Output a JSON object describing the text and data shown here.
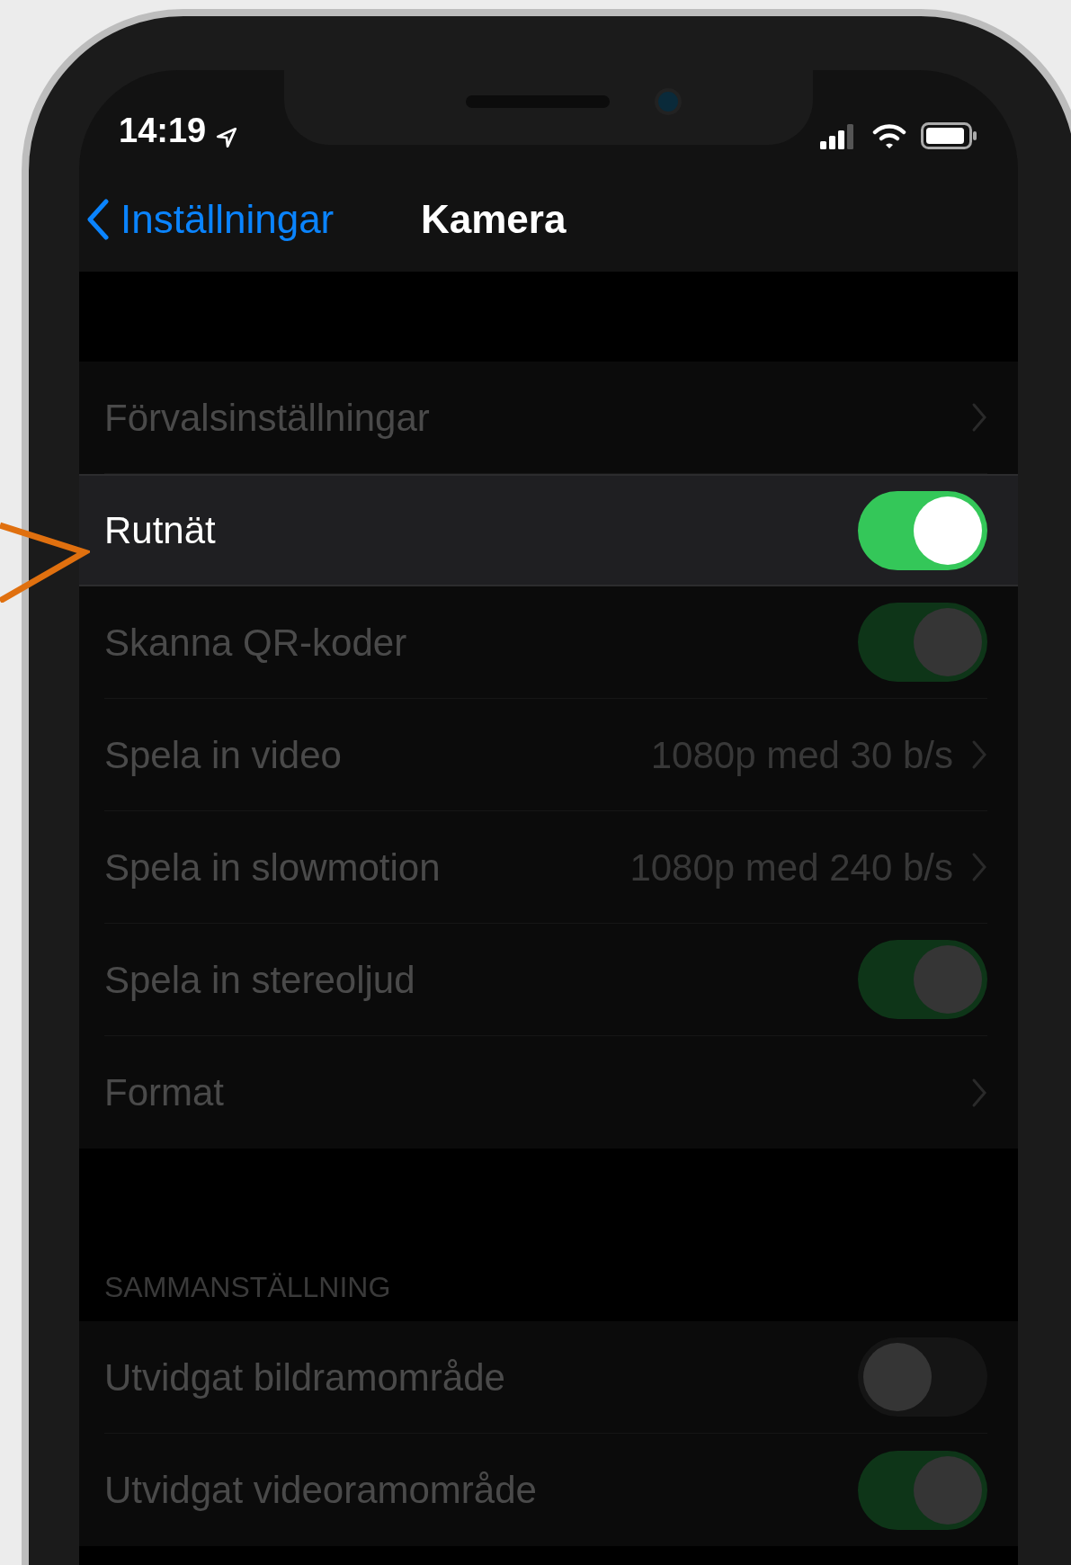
{
  "status_bar": {
    "time": "14:19"
  },
  "nav": {
    "back": "Inställningar",
    "title": "Kamera"
  },
  "sections": [
    {
      "rows": [
        {
          "kind": "link",
          "label": "Förvalsinställningar",
          "highlighted": false
        },
        {
          "kind": "toggle",
          "label": "Rutnät",
          "on": true,
          "highlighted": true
        },
        {
          "kind": "toggle",
          "label": "Skanna QR-koder",
          "on": true,
          "highlighted": false
        },
        {
          "kind": "link",
          "label": "Spela in video",
          "value": "1080p med 30 b/s",
          "highlighted": false
        },
        {
          "kind": "link",
          "label": "Spela in slowmotion",
          "value": "1080p med 240 b/s",
          "highlighted": false
        },
        {
          "kind": "toggle",
          "label": "Spela in stereoljud",
          "on": true,
          "highlighted": false
        },
        {
          "kind": "link",
          "label": "Format",
          "highlighted": false
        }
      ]
    },
    {
      "header": "SAMMANSTÄLLNING",
      "rows": [
        {
          "kind": "toggle",
          "label": "Utvidgat bildramområde",
          "on": false,
          "highlighted": false
        },
        {
          "kind": "toggle",
          "label": "Utvidgat videoramområde",
          "on": true,
          "highlighted": false
        }
      ]
    }
  ]
}
